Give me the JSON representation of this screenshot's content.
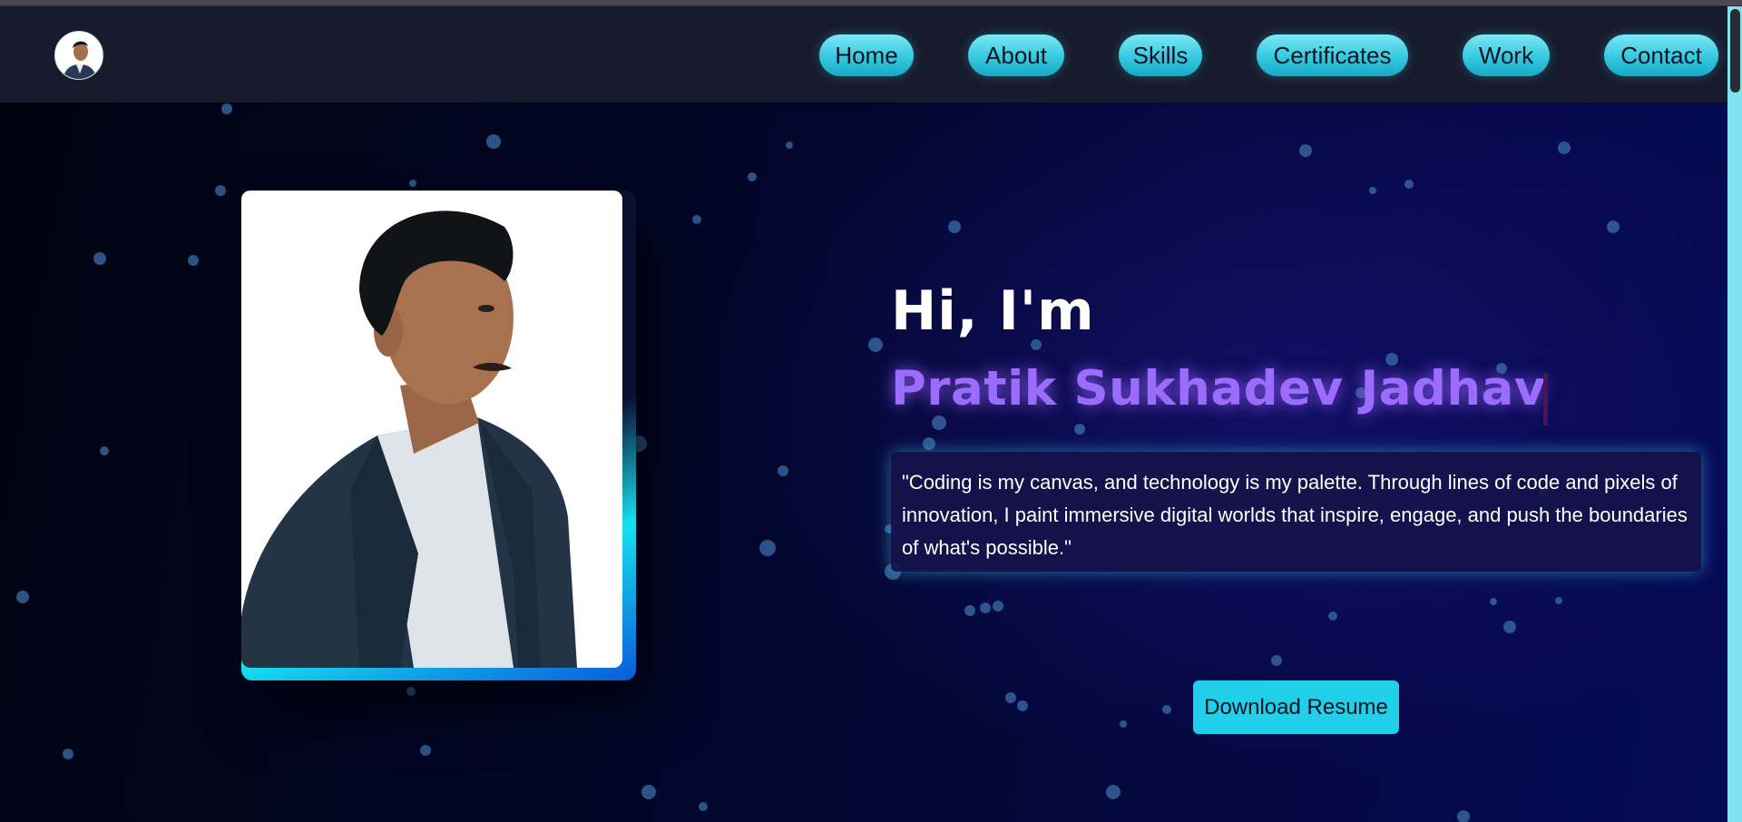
{
  "nav": {
    "logo_alt": "Pratik avatar",
    "links": [
      {
        "label": "Home"
      },
      {
        "label": "About"
      },
      {
        "label": "Skills"
      },
      {
        "label": "Certificates"
      },
      {
        "label": "Work"
      },
      {
        "label": "Contact"
      }
    ]
  },
  "hero": {
    "greeting": "Hi, I'm",
    "name": "Pratik Sukhadev Jadhav",
    "quote": "\"Coding is my canvas, and technology is my palette. Through lines of code and pixels of innovation, I paint immersive digital worlds that inspire, engage, and push the boundaries of what's possible.\"",
    "download_label": "Download Resume"
  },
  "colors": {
    "nav_bg": "#171b2b",
    "nav_button": "#34c9e0",
    "name_accent": "#9b6cff",
    "download_button": "#20d0ea",
    "hero_bg": "#010628"
  }
}
